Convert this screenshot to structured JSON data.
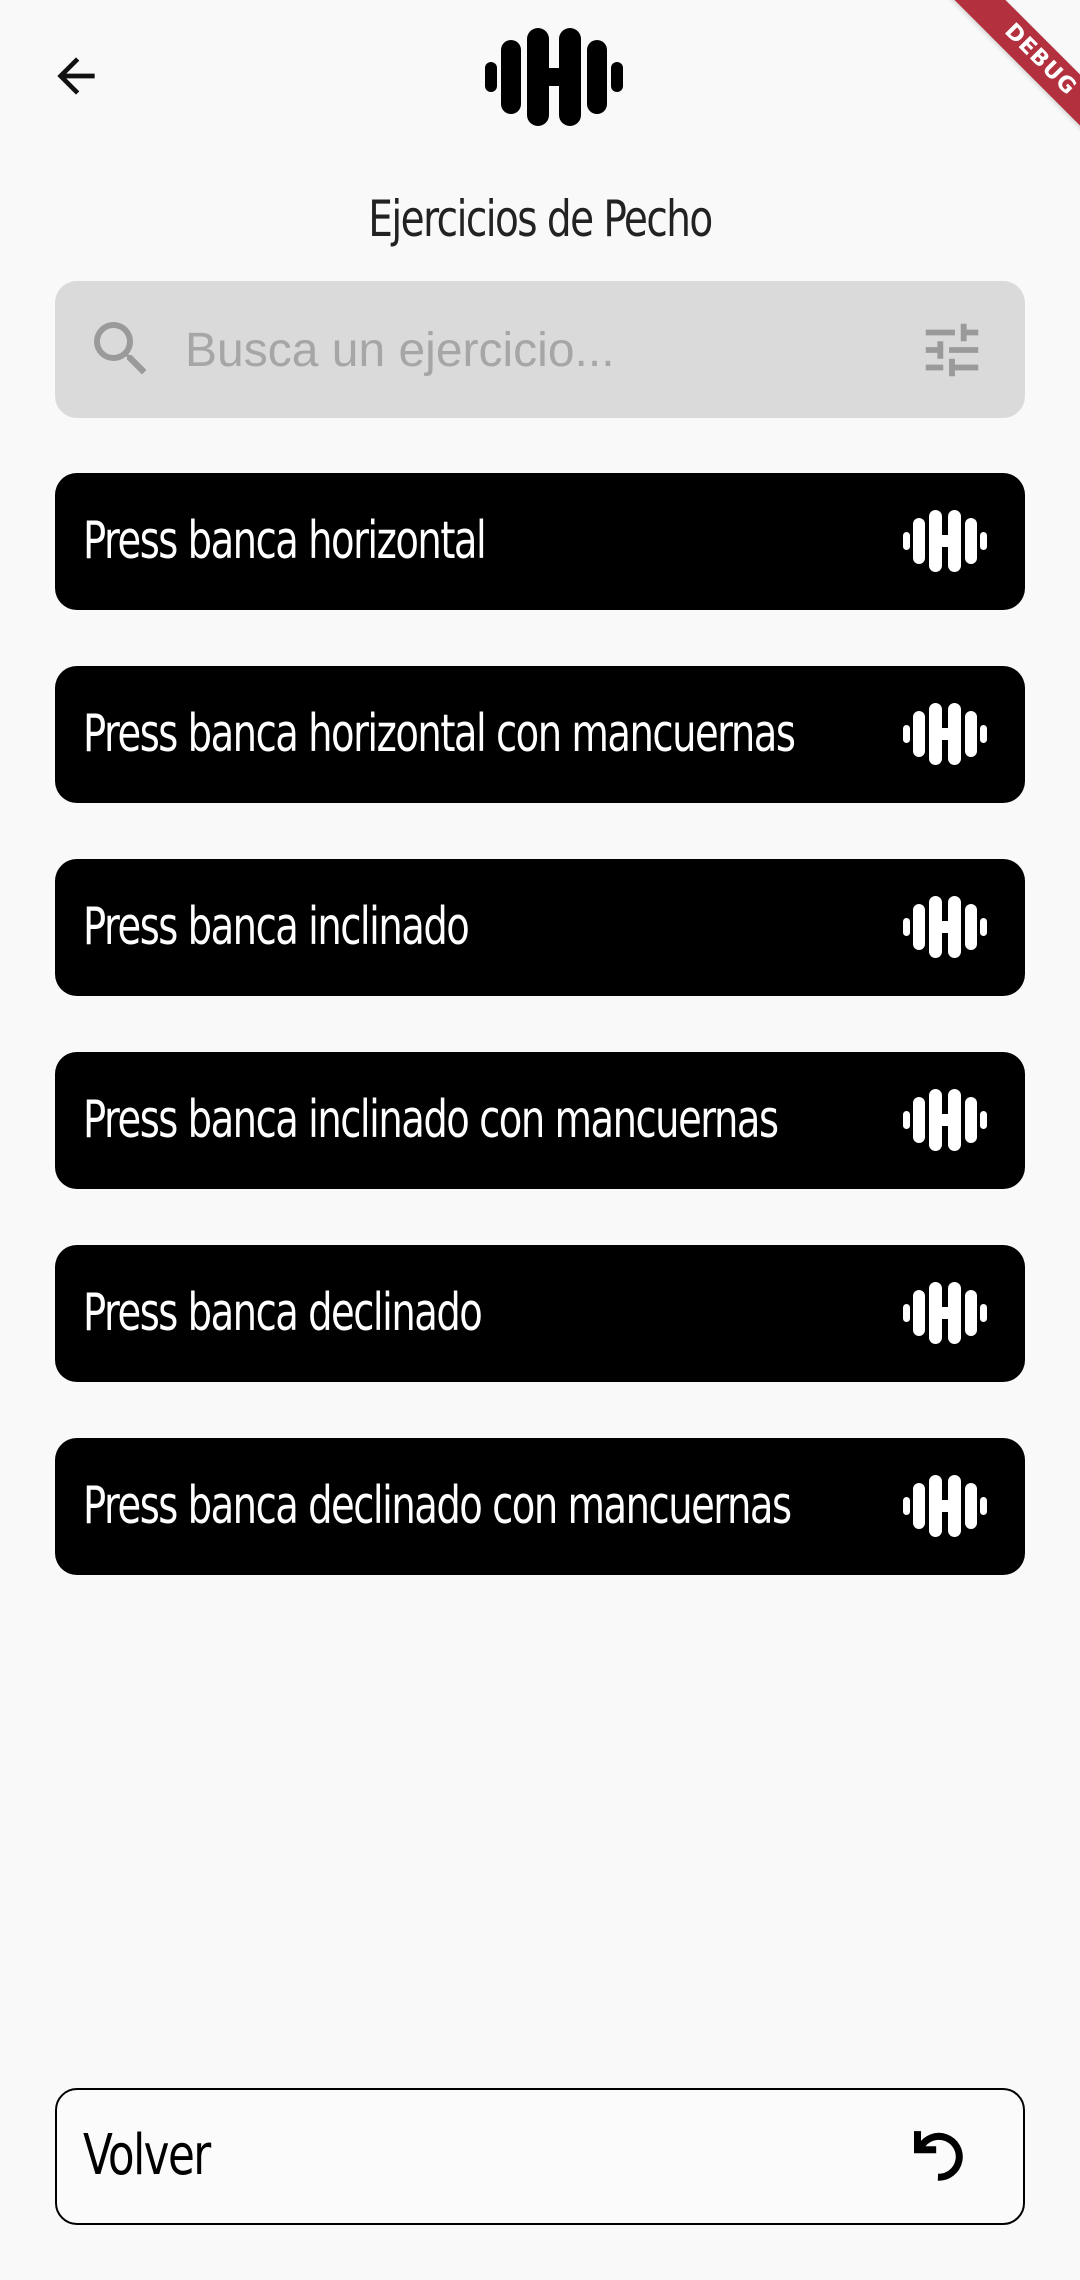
{
  "header": {
    "back_icon": "arrow-left-icon",
    "logo_icon": "dumbbell-icon",
    "title": "Ejercicios de Pecho"
  },
  "search": {
    "placeholder": "Busca un ejercicio...",
    "value": "",
    "search_icon": "search-icon",
    "filter_icon": "tune-icon"
  },
  "exercises": [
    {
      "label": "Press banca horizontal",
      "icon": "dumbbell-icon"
    },
    {
      "label": "Press banca horizontal con mancuernas",
      "icon": "dumbbell-icon"
    },
    {
      "label": "Press banca inclinado",
      "icon": "dumbbell-icon"
    },
    {
      "label": "Press banca inclinado con mancuernas",
      "icon": "dumbbell-icon"
    },
    {
      "label": "Press banca declinado",
      "icon": "dumbbell-icon"
    },
    {
      "label": "Press banca declinado con mancuernas",
      "icon": "dumbbell-icon"
    }
  ],
  "footer": {
    "back_label": "Volver",
    "back_icon": "undo-icon"
  },
  "debug_banner": "DEBUG",
  "colors": {
    "background": "#f9f9f9",
    "item_background": "#000000",
    "item_text": "#ffffff",
    "search_background": "#dadada",
    "placeholder": "#a6a6a6",
    "debug_banner": "#b3303e"
  }
}
